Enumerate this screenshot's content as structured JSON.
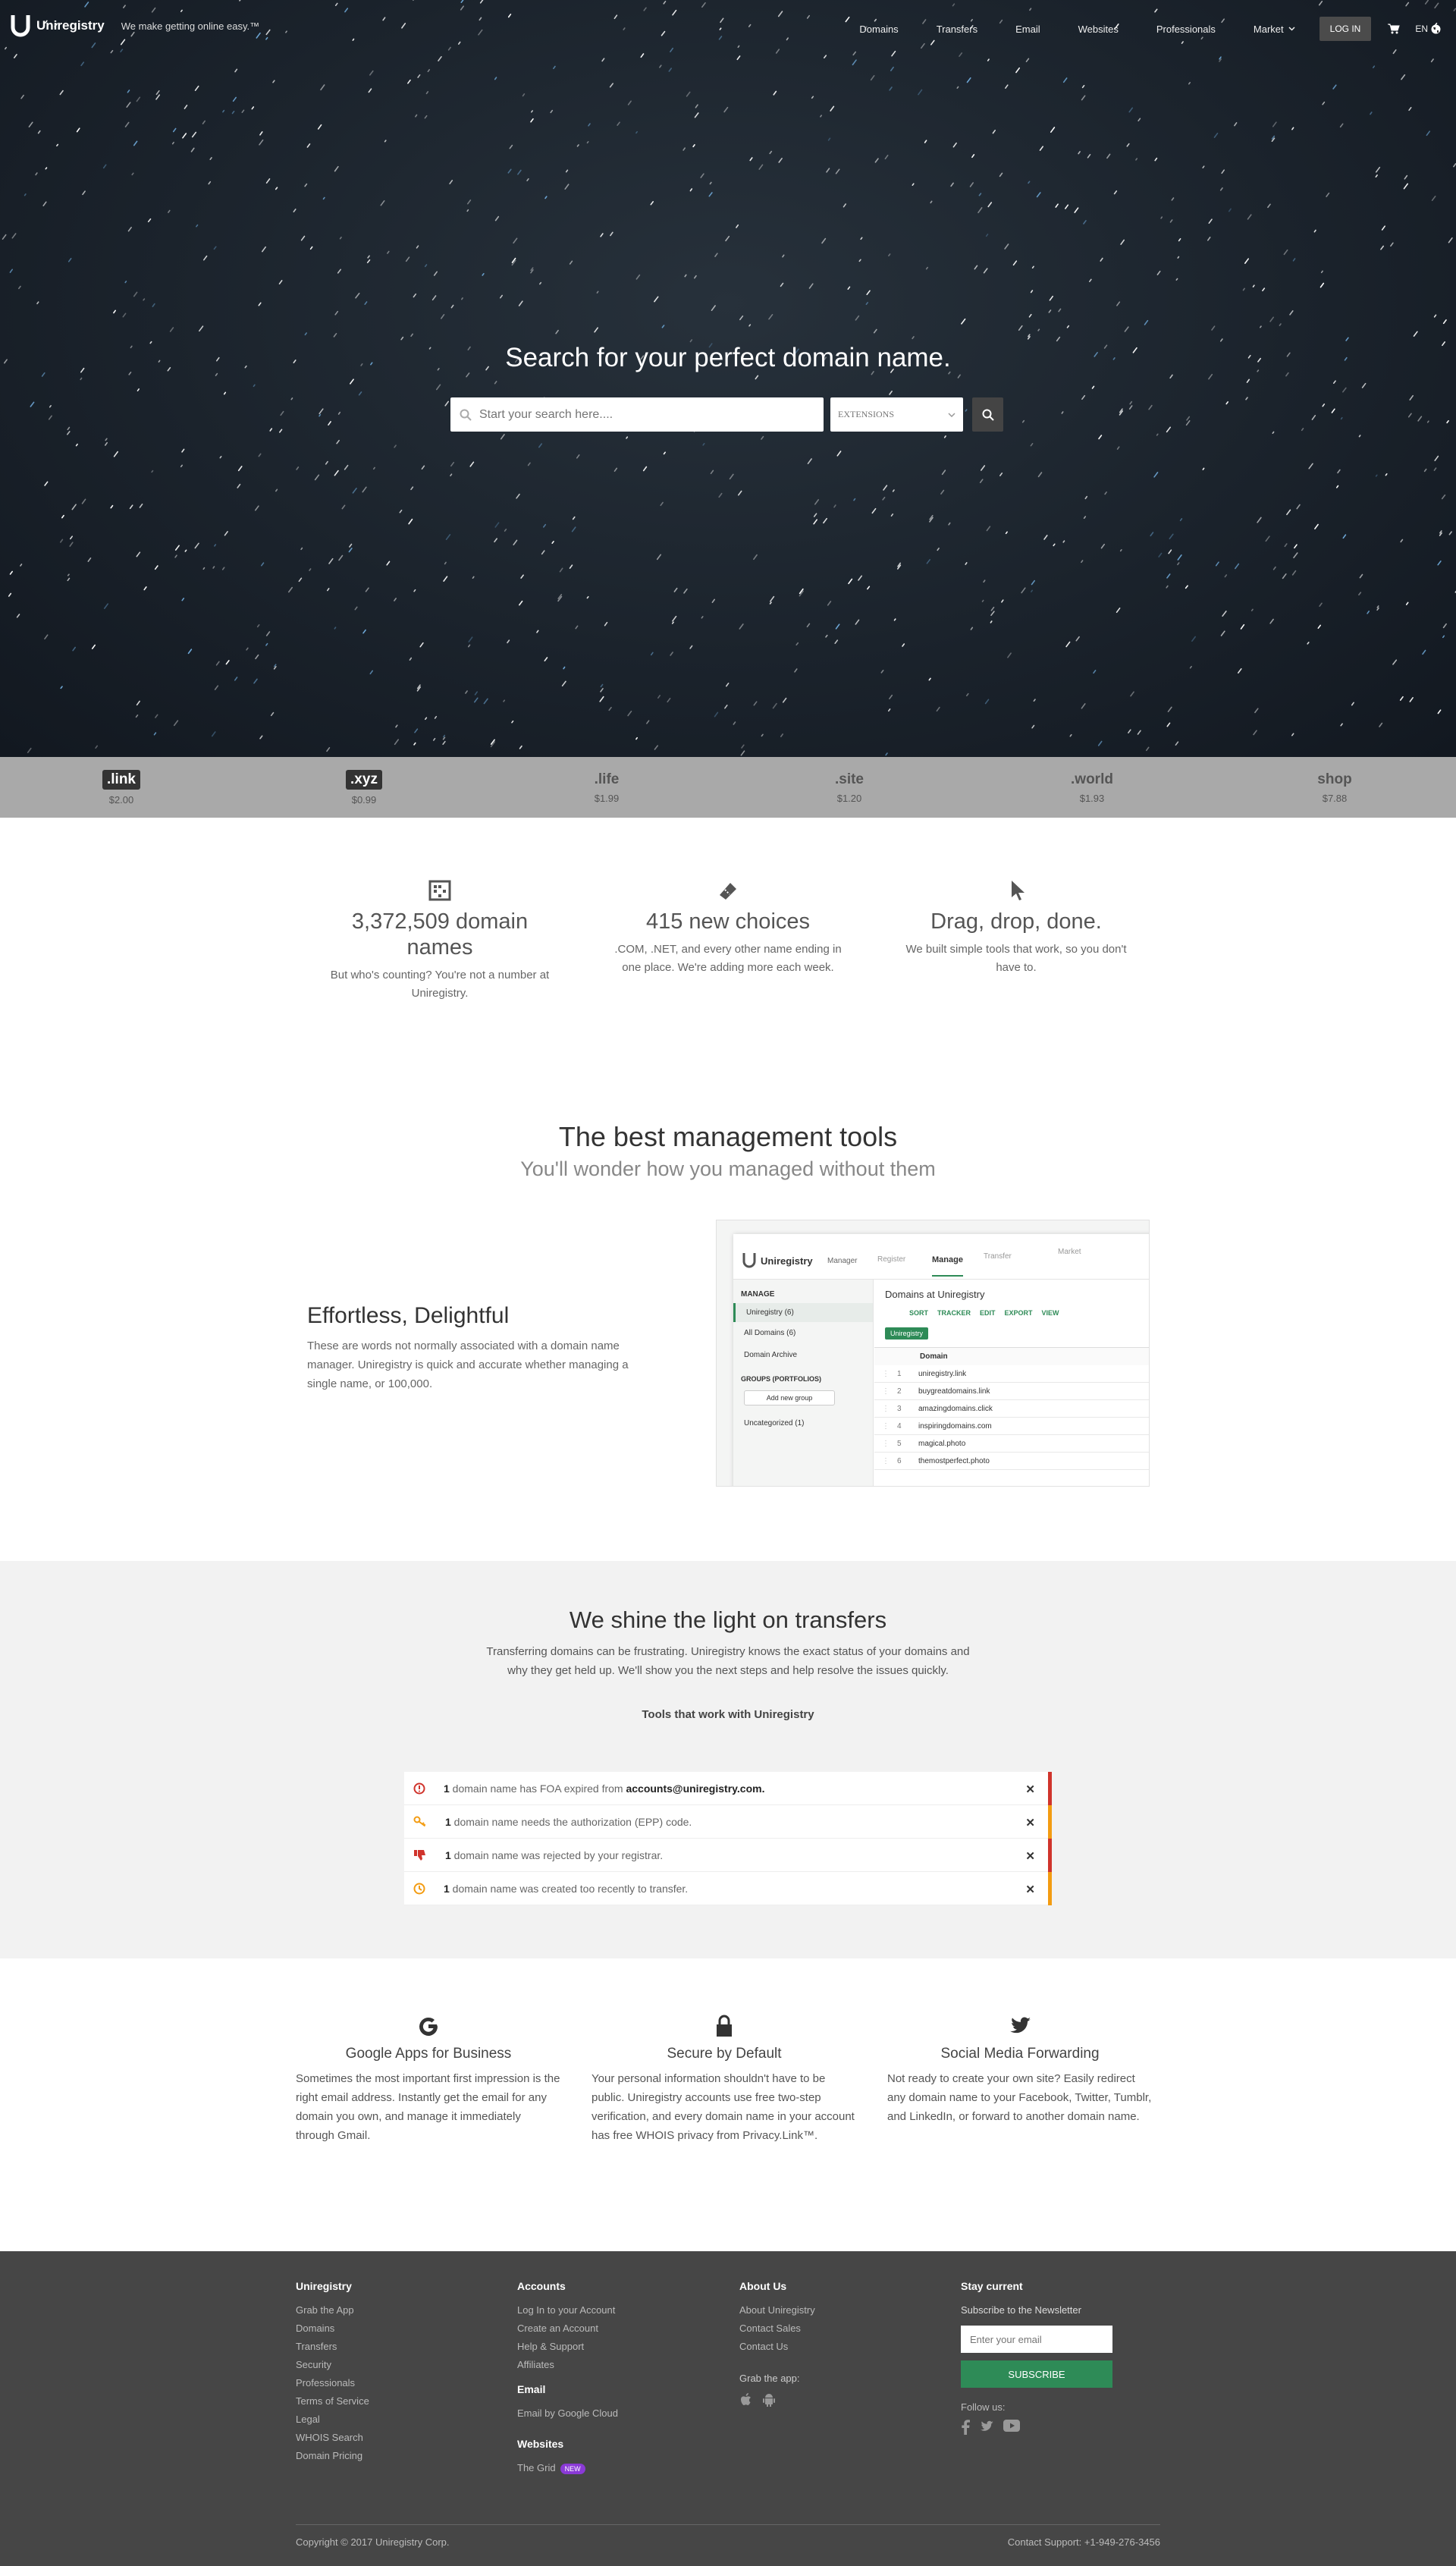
{
  "header": {
    "brand": "Uniregistry",
    "tagline": "We make getting online easy.™",
    "menu": [
      "Domains",
      "Transfers",
      "Email",
      "Websites",
      "Professionals",
      "Market"
    ],
    "login": "LOG IN",
    "lang": "EN"
  },
  "hero": {
    "title": "Search for your perfect domain name.",
    "search_placeholder": "Start your search here....",
    "extensions_label": "EXTENSIONS"
  },
  "tlds": [
    {
      "name": ".link",
      "price": "$2.00"
    },
    {
      "name": ".xyz",
      "price": "$0.99"
    },
    {
      "name": ".life",
      "price": "$1.99"
    },
    {
      "name": ".site",
      "price": "$1.20"
    },
    {
      "name": ".world",
      "price": "$1.93"
    },
    {
      "name": "shop",
      "price": "$7.88"
    }
  ],
  "stats": [
    {
      "icon": "abacus-icon",
      "title": "3,372,509 domain names",
      "body": "But who's counting? You're not a number at Uniregistry."
    },
    {
      "icon": "ticket-icon",
      "title": "415 new choices",
      "body": ".COM, .NET, and every other name ending in one place. We're adding more each week."
    },
    {
      "icon": "cursor-icon",
      "title": "Drag, drop, done.",
      "body": "We built simple tools that work, so you don't have to."
    }
  ],
  "management": {
    "title": "The best management tools",
    "subtitle": "You'll wonder how you managed without them",
    "feature_title": "Effortless, Delightful",
    "feature_body": "These are words not normally associated with a domain name manager.  Uniregistry is quick and accurate whether managing a single name, or 100,000.",
    "app": {
      "brand": "Uniregistry",
      "tabs": [
        "Manager",
        "Register",
        "Manage",
        "Transfer",
        "Market"
      ],
      "sidebar_head": "MANAGE",
      "sidebar_items": [
        "Uniregistry (6)",
        "All Domains (6)",
        "Domain Archive"
      ],
      "groups_head": "GROUPS (PORTFOLIOS)",
      "add_group": "Add new group",
      "uncategorized": "Uncategorized (1)",
      "panel_title": "Domains at Uniregistry",
      "toolbar": [
        "SORT",
        "TRACKER",
        "EDIT",
        "EXPORT",
        "VIEW"
      ],
      "filter_tag": "Uniregistry",
      "col_domain": "Domain",
      "domains": [
        "uniregistry.link",
        "buygreatdomains.link",
        "amazingdomains.click",
        "inspiringdomains.com",
        "magical.photo",
        "themostperfect.photo"
      ]
    }
  },
  "transfers": {
    "title": "We shine the light on transfers",
    "body": "Transferring domains can be frustrating.  Uniregistry knows the exact status of your domains and why they get held up.  We'll show you the next steps and help resolve the issues quickly.",
    "tools": "Tools that work with Uniregistry",
    "alerts": [
      {
        "icon": "alert-clock-icon",
        "count": "1",
        "text": " domain name has FOA expired from ",
        "bold": "accounts@uniregistry.com.",
        "color": "#d0342c"
      },
      {
        "icon": "key-icon",
        "count": "1",
        "text": " domain name needs the authorization (EPP) code.",
        "bold": "",
        "color": "#f39c12"
      },
      {
        "icon": "thumbs-down-icon",
        "count": "1",
        "text": " domain name was rejected by your registrar.",
        "bold": "",
        "color": "#d0342c"
      },
      {
        "icon": "clock-icon",
        "count": "1",
        "text": " domain name was created too recently to transfer.",
        "bold": "",
        "color": "#f39c12"
      }
    ]
  },
  "features": [
    {
      "icon": "google-icon",
      "title": "Google Apps for Business",
      "body": "Sometimes the most important first impression is the right email address. Instantly get the email for any domain you own, and manage it immediately through Gmail."
    },
    {
      "icon": "lock-icon",
      "title": "Secure by Default",
      "body": "Your personal information shouldn't have to be public. Uniregistry accounts use free two-step verification, and every domain name in your account has free WHOIS privacy from Privacy.Link™."
    },
    {
      "icon": "twitter-icon",
      "title": "Social Media Forwarding",
      "body": "Not ready to create your own site? Easily redirect any domain name to your Facebook, Twitter, Tumblr, and LinkedIn, or forward to another domain name."
    }
  ],
  "footer": {
    "col1": {
      "title": "Uniregistry",
      "links": [
        "Grab the App",
        "Domains",
        "Transfers",
        "Security",
        "Professionals",
        "Terms of Service",
        "Legal",
        "WHOIS Search",
        "Domain Pricing"
      ]
    },
    "col2": {
      "title": "Accounts",
      "links": [
        "Log In to your Account",
        "Create an Account",
        "Help & Support",
        "Affiliates"
      ],
      "email_title": "Email",
      "email_links": [
        "Email by Google Cloud"
      ],
      "web_title": "Websites",
      "web_link": "The Grid",
      "new_badge": "NEW"
    },
    "col3": {
      "title": "About Us",
      "links": [
        "About Uniregistry",
        "Contact Sales",
        "Contact Us"
      ],
      "app_title": "Grab the app:"
    },
    "col4": {
      "title": "Stay current",
      "subscribe_label": "Subscribe to the Newsletter",
      "email_placeholder": "Enter your email",
      "button": "SUBSCRIBE",
      "follow": "Follow us:"
    },
    "copyright": "Copyright © 2017 Uniregistry Corp.",
    "support": "Contact Support: +1-949-276-3456"
  },
  "colors": {
    "accent_green": "#2e8b57",
    "alert_red": "#d0342c",
    "alert_orange": "#f39c12",
    "footer_bg": "#464646"
  }
}
